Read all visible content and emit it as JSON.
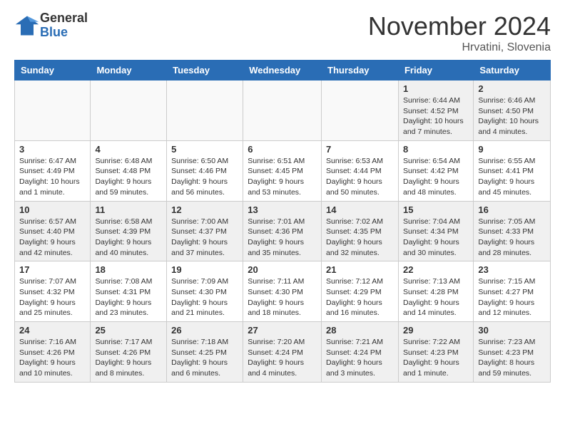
{
  "header": {
    "logo_general": "General",
    "logo_blue": "Blue",
    "month_title": "November 2024",
    "location": "Hrvatini, Slovenia"
  },
  "weekdays": [
    "Sunday",
    "Monday",
    "Tuesday",
    "Wednesday",
    "Thursday",
    "Friday",
    "Saturday"
  ],
  "weeks": [
    [
      {
        "day": "",
        "empty": true
      },
      {
        "day": "",
        "empty": true
      },
      {
        "day": "",
        "empty": true
      },
      {
        "day": "",
        "empty": true
      },
      {
        "day": "",
        "empty": true
      },
      {
        "day": "1",
        "sunrise": "Sunrise: 6:44 AM",
        "sunset": "Sunset: 4:52 PM",
        "daylight": "Daylight: 10 hours and 7 minutes."
      },
      {
        "day": "2",
        "sunrise": "Sunrise: 6:46 AM",
        "sunset": "Sunset: 4:50 PM",
        "daylight": "Daylight: 10 hours and 4 minutes."
      }
    ],
    [
      {
        "day": "3",
        "sunrise": "Sunrise: 6:47 AM",
        "sunset": "Sunset: 4:49 PM",
        "daylight": "Daylight: 10 hours and 1 minute."
      },
      {
        "day": "4",
        "sunrise": "Sunrise: 6:48 AM",
        "sunset": "Sunset: 4:48 PM",
        "daylight": "Daylight: 9 hours and 59 minutes."
      },
      {
        "day": "5",
        "sunrise": "Sunrise: 6:50 AM",
        "sunset": "Sunset: 4:46 PM",
        "daylight": "Daylight: 9 hours and 56 minutes."
      },
      {
        "day": "6",
        "sunrise": "Sunrise: 6:51 AM",
        "sunset": "Sunset: 4:45 PM",
        "daylight": "Daylight: 9 hours and 53 minutes."
      },
      {
        "day": "7",
        "sunrise": "Sunrise: 6:53 AM",
        "sunset": "Sunset: 4:44 PM",
        "daylight": "Daylight: 9 hours and 50 minutes."
      },
      {
        "day": "8",
        "sunrise": "Sunrise: 6:54 AM",
        "sunset": "Sunset: 4:42 PM",
        "daylight": "Daylight: 9 hours and 48 minutes."
      },
      {
        "day": "9",
        "sunrise": "Sunrise: 6:55 AM",
        "sunset": "Sunset: 4:41 PM",
        "daylight": "Daylight: 9 hours and 45 minutes."
      }
    ],
    [
      {
        "day": "10",
        "sunrise": "Sunrise: 6:57 AM",
        "sunset": "Sunset: 4:40 PM",
        "daylight": "Daylight: 9 hours and 42 minutes."
      },
      {
        "day": "11",
        "sunrise": "Sunrise: 6:58 AM",
        "sunset": "Sunset: 4:39 PM",
        "daylight": "Daylight: 9 hours and 40 minutes."
      },
      {
        "day": "12",
        "sunrise": "Sunrise: 7:00 AM",
        "sunset": "Sunset: 4:37 PM",
        "daylight": "Daylight: 9 hours and 37 minutes."
      },
      {
        "day": "13",
        "sunrise": "Sunrise: 7:01 AM",
        "sunset": "Sunset: 4:36 PM",
        "daylight": "Daylight: 9 hours and 35 minutes."
      },
      {
        "day": "14",
        "sunrise": "Sunrise: 7:02 AM",
        "sunset": "Sunset: 4:35 PM",
        "daylight": "Daylight: 9 hours and 32 minutes."
      },
      {
        "day": "15",
        "sunrise": "Sunrise: 7:04 AM",
        "sunset": "Sunset: 4:34 PM",
        "daylight": "Daylight: 9 hours and 30 minutes."
      },
      {
        "day": "16",
        "sunrise": "Sunrise: 7:05 AM",
        "sunset": "Sunset: 4:33 PM",
        "daylight": "Daylight: 9 hours and 28 minutes."
      }
    ],
    [
      {
        "day": "17",
        "sunrise": "Sunrise: 7:07 AM",
        "sunset": "Sunset: 4:32 PM",
        "daylight": "Daylight: 9 hours and 25 minutes."
      },
      {
        "day": "18",
        "sunrise": "Sunrise: 7:08 AM",
        "sunset": "Sunset: 4:31 PM",
        "daylight": "Daylight: 9 hours and 23 minutes."
      },
      {
        "day": "19",
        "sunrise": "Sunrise: 7:09 AM",
        "sunset": "Sunset: 4:30 PM",
        "daylight": "Daylight: 9 hours and 21 minutes."
      },
      {
        "day": "20",
        "sunrise": "Sunrise: 7:11 AM",
        "sunset": "Sunset: 4:30 PM",
        "daylight": "Daylight: 9 hours and 18 minutes."
      },
      {
        "day": "21",
        "sunrise": "Sunrise: 7:12 AM",
        "sunset": "Sunset: 4:29 PM",
        "daylight": "Daylight: 9 hours and 16 minutes."
      },
      {
        "day": "22",
        "sunrise": "Sunrise: 7:13 AM",
        "sunset": "Sunset: 4:28 PM",
        "daylight": "Daylight: 9 hours and 14 minutes."
      },
      {
        "day": "23",
        "sunrise": "Sunrise: 7:15 AM",
        "sunset": "Sunset: 4:27 PM",
        "daylight": "Daylight: 9 hours and 12 minutes."
      }
    ],
    [
      {
        "day": "24",
        "sunrise": "Sunrise: 7:16 AM",
        "sunset": "Sunset: 4:26 PM",
        "daylight": "Daylight: 9 hours and 10 minutes."
      },
      {
        "day": "25",
        "sunrise": "Sunrise: 7:17 AM",
        "sunset": "Sunset: 4:26 PM",
        "daylight": "Daylight: 9 hours and 8 minutes."
      },
      {
        "day": "26",
        "sunrise": "Sunrise: 7:18 AM",
        "sunset": "Sunset: 4:25 PM",
        "daylight": "Daylight: 9 hours and 6 minutes."
      },
      {
        "day": "27",
        "sunrise": "Sunrise: 7:20 AM",
        "sunset": "Sunset: 4:24 PM",
        "daylight": "Daylight: 9 hours and 4 minutes."
      },
      {
        "day": "28",
        "sunrise": "Sunrise: 7:21 AM",
        "sunset": "Sunset: 4:24 PM",
        "daylight": "Daylight: 9 hours and 3 minutes."
      },
      {
        "day": "29",
        "sunrise": "Sunrise: 7:22 AM",
        "sunset": "Sunset: 4:23 PM",
        "daylight": "Daylight: 9 hours and 1 minute."
      },
      {
        "day": "30",
        "sunrise": "Sunrise: 7:23 AM",
        "sunset": "Sunset: 4:23 PM",
        "daylight": "Daylight: 8 hours and 59 minutes."
      }
    ]
  ]
}
